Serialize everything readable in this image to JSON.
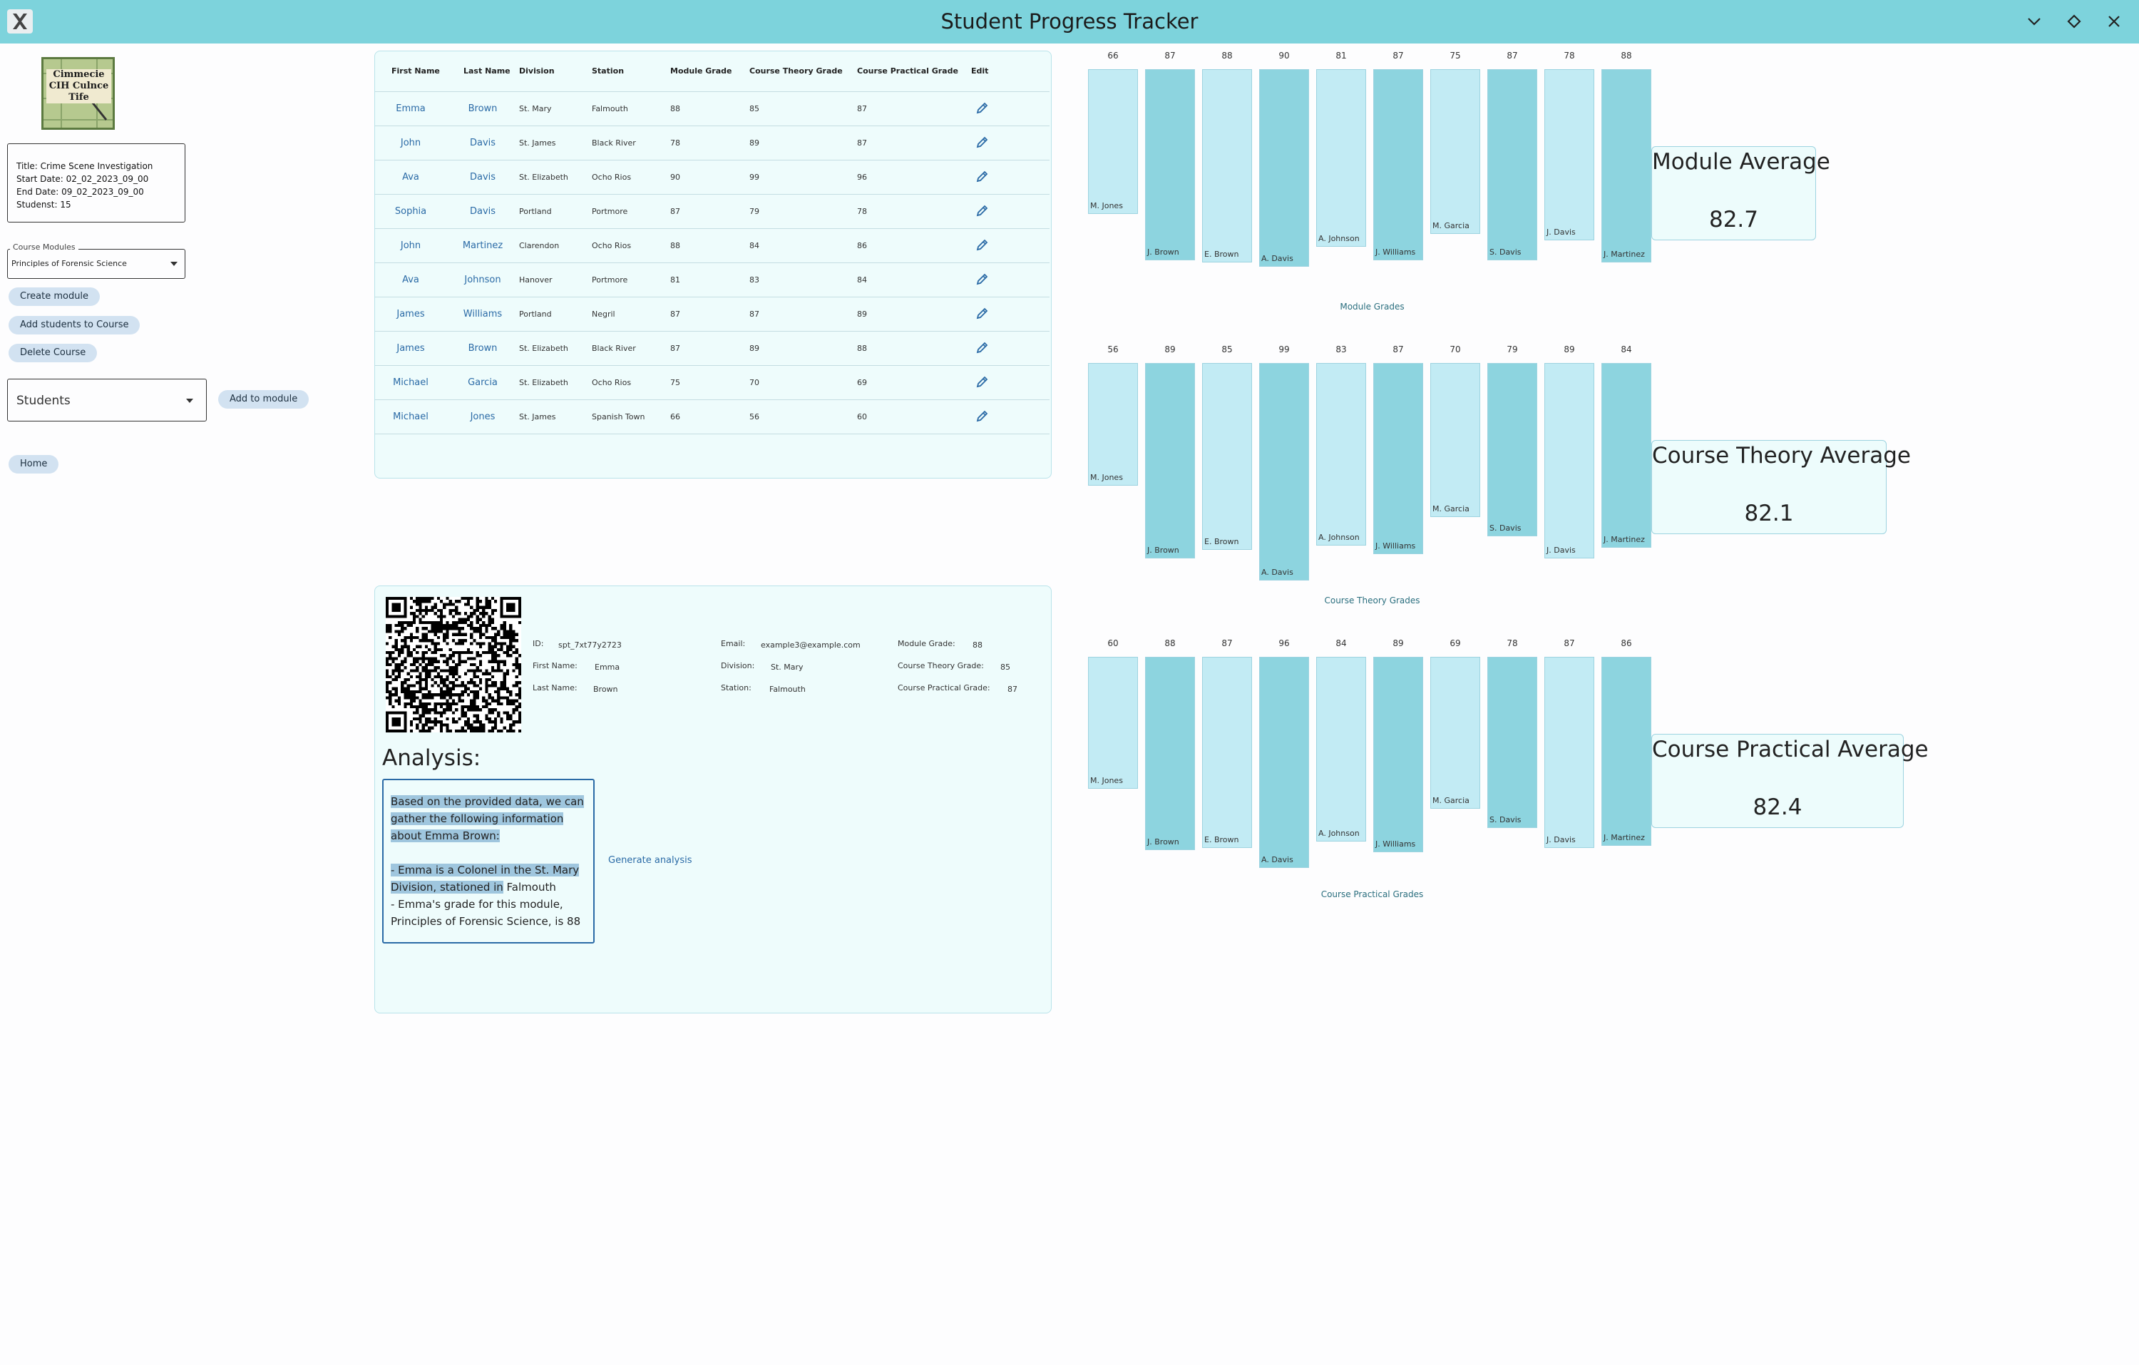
{
  "window": {
    "title": "Student Progress Tracker"
  },
  "logo": {
    "text": "Cimmecie CIH Culnce Tife"
  },
  "course_info": {
    "title": "Title: Crime Scene Investigation",
    "start": "Start Date: 02_02_2023_09_00",
    "end": "End Date: 09_02_2023_09_00",
    "students": "Studenst: 15"
  },
  "modules_select": {
    "label": "Course Modules",
    "value": "Principles of Forensic Science"
  },
  "buttons": {
    "create_module": "Create module",
    "add_students": "Add students to Course",
    "delete_course": "Delete Course",
    "add_to_module": "Add to module",
    "home": "Home"
  },
  "students_select": {
    "value": "Students"
  },
  "table": {
    "headers": [
      "First Name",
      "Last Name",
      "Division",
      "Station",
      "Module Grade",
      "Course Theory Grade",
      "Course Practical Grade",
      "Edit"
    ],
    "rows": [
      [
        "Emma",
        "Brown",
        "St. Mary",
        "Falmouth",
        "88",
        "85",
        "87"
      ],
      [
        "John",
        "Davis",
        "St. James",
        "Black River",
        "78",
        "89",
        "87"
      ],
      [
        "Ava",
        "Davis",
        "St. Elizabeth",
        "Ocho Rios",
        "90",
        "99",
        "96"
      ],
      [
        "Sophia",
        "Davis",
        "Portland",
        "Portmore",
        "87",
        "79",
        "78"
      ],
      [
        "John",
        "Martinez",
        "Clarendon",
        "Ocho Rios",
        "88",
        "84",
        "86"
      ],
      [
        "Ava",
        "Johnson",
        "Hanover",
        "Portmore",
        "81",
        "83",
        "84"
      ],
      [
        "James",
        "Williams",
        "Portland",
        "Negril",
        "87",
        "87",
        "89"
      ],
      [
        "James",
        "Brown",
        "St. Elizabeth",
        "Black River",
        "87",
        "89",
        "88"
      ],
      [
        "Michael",
        "Garcia",
        "St. Elizabeth",
        "Ocho Rios",
        "75",
        "70",
        "69"
      ],
      [
        "Michael",
        "Jones",
        "St. James",
        "Spanish Town",
        "66",
        "56",
        "60"
      ]
    ]
  },
  "detail": {
    "id_label": "ID:",
    "id_value": "spt_7xt77y2723",
    "first_label": "First Name:",
    "first_value": "Emma",
    "last_label": "Last Name:",
    "last_value": "Brown",
    "email_label": "Email:",
    "email_value": "example3@example.com",
    "division_label": "Division:",
    "division_value": "St. Mary",
    "station_label": "Station:",
    "station_value": "Falmouth",
    "module_label": "Module Grade:",
    "module_value": "88",
    "theory_label": "Course Theory Grade:",
    "theory_value": "85",
    "practical_label": "Course Practical Grade:",
    "practical_value": "87",
    "analysis_heading": "Analysis:",
    "analysis_p1": "Based on the provided data, we can gather the following information about Emma Brown:",
    "analysis_p2_sel": "- Emma is a Colonel in the St. Mary Division, stationed in",
    "analysis_p2_rest": " Falmouth",
    "analysis_p3": "- Emma's grade for this module, Principles of Forensic Science, is 88",
    "generate": "Generate analysis"
  },
  "chart_data": [
    {
      "type": "bar",
      "title": "Module Grades",
      "categories": [
        "M. Jones",
        "J. Brown",
        "E. Brown",
        "A. Davis",
        "A. Johnson",
        "J. Williams",
        "M. Garcia",
        "S. Davis",
        "J. Davis",
        "J. Martinez"
      ],
      "values": [
        66,
        87,
        88,
        90,
        81,
        87,
        75,
        87,
        78,
        88
      ],
      "average_label": "Module Average",
      "average": "82.7"
    },
    {
      "type": "bar",
      "title": "Course Theory Grades",
      "categories": [
        "M. Jones",
        "J. Brown",
        "E. Brown",
        "A. Davis",
        "A. Johnson",
        "J. Williams",
        "M. Garcia",
        "S. Davis",
        "J. Davis",
        "J. Martinez"
      ],
      "values": [
        56,
        89,
        85,
        99,
        83,
        87,
        70,
        79,
        89,
        84
      ],
      "average_label": "Course Theory Average",
      "average": "82.1"
    },
    {
      "type": "bar",
      "title": "Course Practical Grades",
      "categories": [
        "M. Jones",
        "J. Brown",
        "E. Brown",
        "A. Davis",
        "A. Johnson",
        "J. Williams",
        "M. Garcia",
        "S. Davis",
        "J. Davis",
        "J. Martinez"
      ],
      "values": [
        60,
        88,
        87,
        96,
        84,
        89,
        69,
        78,
        87,
        86
      ],
      "average_label": "Course Practical Average",
      "average": "82.4"
    }
  ],
  "colors": {
    "titlebar": "#7dd3dc",
    "bar_light": "#c2ebf4",
    "bar_dark": "#8dd4df",
    "link": "#2a6aa6"
  }
}
